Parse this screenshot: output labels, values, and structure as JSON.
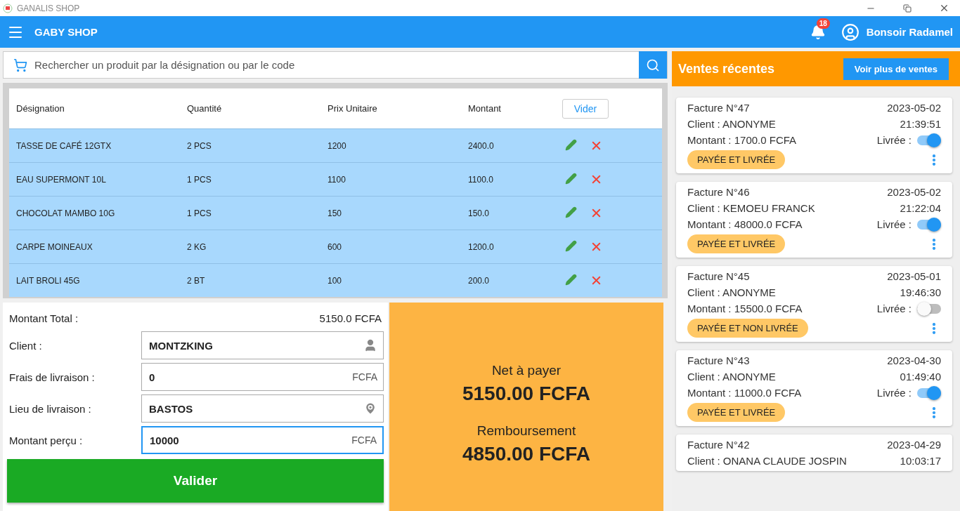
{
  "window": {
    "title": "GANALIS SHOP"
  },
  "app_bar": {
    "title": "GABY SHOP",
    "notifications": "18",
    "greeting": "Bonsoir Radamel"
  },
  "search": {
    "placeholder": "Rechercher un produit par la désignation ou par le code"
  },
  "cart": {
    "columns": [
      "Désignation",
      "Quantité",
      "Prix Unitaire",
      "Montant"
    ],
    "clear_button": "Vider",
    "rows": [
      {
        "designation": "TASSE DE CAFÉ 12GTX",
        "quantity": "2  PCS",
        "unit_price": "1200",
        "amount": "2400.0"
      },
      {
        "designation": "EAU SUPERMONT 10L",
        "quantity": "1  PCS",
        "unit_price": "1100",
        "amount": "1100.0"
      },
      {
        "designation": "CHOCOLAT MAMBO 10G",
        "quantity": "1  PCS",
        "unit_price": "150",
        "amount": "150.0"
      },
      {
        "designation": "CARPE MOINEAUX",
        "quantity": "2  KG",
        "unit_price": "600",
        "amount": "1200.0"
      },
      {
        "designation": "LAIT BROLI 45G",
        "quantity": "2  BT",
        "unit_price": "100",
        "amount": "200.0"
      }
    ]
  },
  "checkout": {
    "total_label": "Montant Total :",
    "total": "5150.0 FCFA",
    "fields": [
      {
        "label": "Client :",
        "value": "MONTZKING",
        "kind": "person",
        "focused": false
      },
      {
        "label": "Frais de livraison :",
        "value": "0",
        "kind": "unit",
        "unit": "FCFA",
        "focused": false
      },
      {
        "label": "Lieu de livraison :",
        "value": "BASTOS",
        "kind": "place",
        "focused": false
      },
      {
        "label": "Montant perçu :",
        "value": "10000",
        "kind": "unit",
        "unit": "FCFA",
        "focused": true
      }
    ],
    "submit": "Valider"
  },
  "summary": {
    "net_label": "Net à payer",
    "net": "5150.00 FCFA",
    "refund_label": "Remboursement",
    "refund": "4850.00 FCFA"
  },
  "recent_sales": {
    "title": "Ventes récentes",
    "more_button": "Voir plus de ventes",
    "items": [
      {
        "invoice": "Facture N°47",
        "date": "2023-05-02",
        "client": "Client : ANONYME",
        "time": "21:39:51",
        "amount": "Montant : 1700.0 FCFA",
        "delivered_label": "Livrée :",
        "on": true,
        "status": "PAYÉE ET LIVRÉE"
      },
      {
        "invoice": "Facture N°46",
        "date": "2023-05-02",
        "client": "Client : KEMOEU FRANCK",
        "time": "21:22:04",
        "amount": "Montant : 48000.0 FCFA",
        "delivered_label": "Livrée :",
        "on": true,
        "status": "PAYÉE ET LIVRÉE"
      },
      {
        "invoice": "Facture N°45",
        "date": "2023-05-01",
        "client": "Client : ANONYME",
        "time": "19:46:30",
        "amount": "Montant : 15500.0 FCFA",
        "delivered_label": "Livrée :",
        "on": false,
        "status": "PAYÉE ET NON LIVRÉE"
      },
      {
        "invoice": "Facture N°43",
        "date": "2023-04-30",
        "client": "Client : ANONYME",
        "time": "01:49:40",
        "amount": "Montant : 11000.0 FCFA",
        "delivered_label": "Livrée :",
        "on": true,
        "status": "PAYÉE ET LIVRÉE"
      },
      {
        "invoice": "Facture N°42",
        "date": "2023-04-29",
        "client": "Client : ONANA  CLAUDE JOSPIN",
        "time": "10:03:17"
      }
    ]
  }
}
